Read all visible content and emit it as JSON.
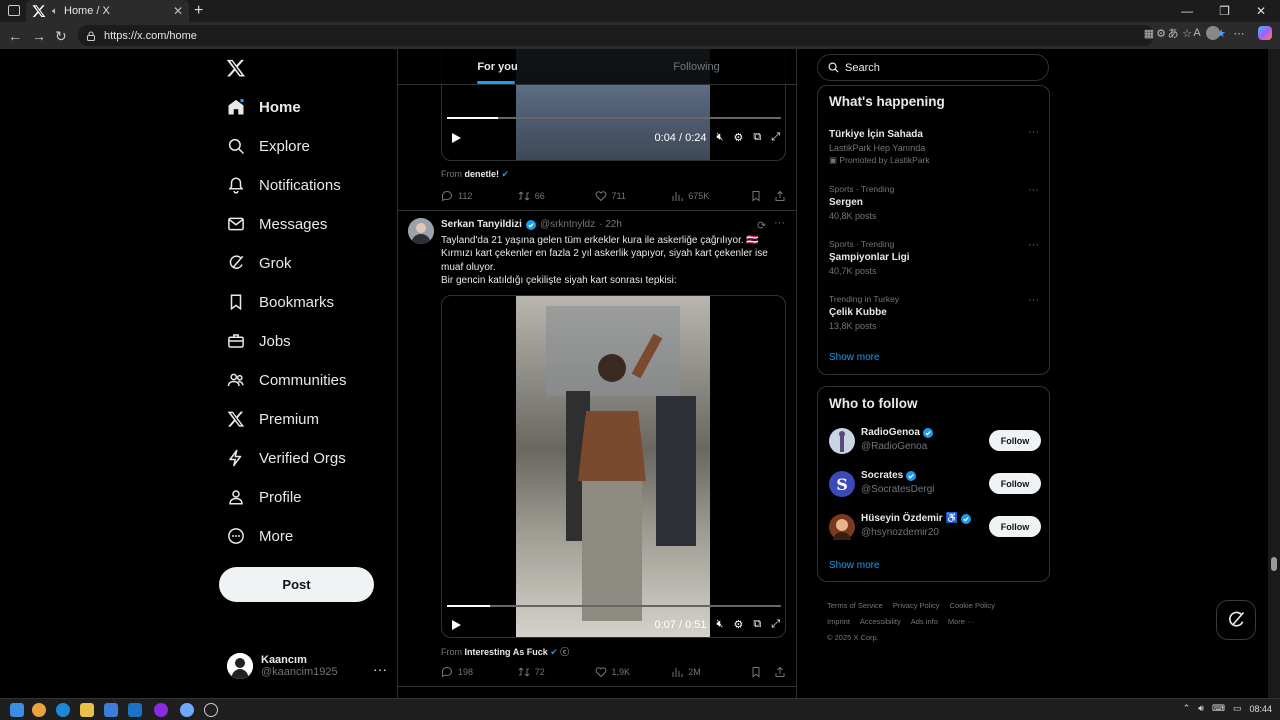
{
  "browser": {
    "tab_title": "Home / X",
    "url": "https://x.com/home",
    "window_controls": [
      "—",
      "❐",
      "✕"
    ]
  },
  "nav": {
    "items": [
      {
        "label": "Home",
        "icon": "home-icon"
      },
      {
        "label": "Explore",
        "icon": "search-icon"
      },
      {
        "label": "Notifications",
        "icon": "bell-icon"
      },
      {
        "label": "Messages",
        "icon": "mail-icon"
      },
      {
        "label": "Grok",
        "icon": "grok-icon"
      },
      {
        "label": "Bookmarks",
        "icon": "bookmark-icon"
      },
      {
        "label": "Jobs",
        "icon": "briefcase-icon"
      },
      {
        "label": "Communities",
        "icon": "people-icon"
      },
      {
        "label": "Premium",
        "icon": "x-icon"
      },
      {
        "label": "Verified Orgs",
        "icon": "lightning-icon"
      },
      {
        "label": "Profile",
        "icon": "person-icon"
      },
      {
        "label": "More",
        "icon": "more-circle-icon"
      }
    ],
    "post_label": "Post",
    "account": {
      "name": "Kaancım",
      "handle": "@kaancim1925"
    }
  },
  "timeline": {
    "tabs": [
      "For you",
      "Following"
    ],
    "tweet1": {
      "video_time": "0:04 / 0:24",
      "from_label": "From",
      "from_name": "denetle!",
      "stats": {
        "replies": "112",
        "reposts": "66",
        "likes": "711",
        "views": "675K"
      }
    },
    "tweet2": {
      "name": "Serkan Tanyildizi",
      "handle": "@srkntnyldz",
      "time": "· 22h",
      "text_lines": [
        "Tayland'da 21 yaşına gelen tüm erkekler kura ile askerliğe çağrılıyor. 🇹🇭",
        "Kırmızı kart çekenler en fazla 2 yıl askerlik yapıyor, siyah kart çekenler ise muaf oluyor.",
        "Bir gencin katıldığı çekilişte siyah kart sonrası tepkisi:"
      ],
      "video_time": "0:07 / 0:51",
      "from_label": "From",
      "from_name": "Interesting As Fuck",
      "stats": {
        "replies": "198",
        "reposts": "72",
        "likes": "1,9K",
        "views": "2M"
      }
    }
  },
  "sidebar": {
    "search_placeholder": "Search",
    "happening": {
      "title": "What's happening",
      "trends": [
        {
          "sub": "",
          "title": "Türkiye İçin Sahada",
          "count": "LastikPark Hep Yanında",
          "promo": "Promoted by LastikPark"
        },
        {
          "sub": "Sports · Trending",
          "title": "Sergen",
          "count": "40,8K posts",
          "promo": ""
        },
        {
          "sub": "Sports · Trending",
          "title": "Şampiyonlar Ligi",
          "count": "40,7K posts",
          "promo": ""
        },
        {
          "sub": "Trending in Turkey",
          "title": "Çelik Kubbe",
          "count": "13,8K posts",
          "promo": ""
        }
      ],
      "show_more": "Show more"
    },
    "who_to_follow": {
      "title": "Who to follow",
      "accounts": [
        {
          "name": "RadioGenoa",
          "handle": "@RadioGenoa",
          "button": "Follow"
        },
        {
          "name": "Socrates",
          "handle": "@SocratesDergi",
          "button": "Follow"
        },
        {
          "name": "Hüseyin Özdemir ♿",
          "handle": "@hsynozdemir20",
          "button": "Follow"
        }
      ],
      "show_more": "Show more"
    },
    "footer": {
      "links": [
        "Terms of Service",
        "Privacy Policy",
        "Cookie Policy",
        "Imprint",
        "Accessibility",
        "Ads info",
        "More ···"
      ],
      "copyright": "© 2025 X Corp."
    }
  },
  "taskbar": {
    "time": "08:44"
  },
  "colors": {
    "accent": "#1d9bf0",
    "background": "#000000",
    "border": "#2f3336",
    "muted": "#71767b"
  }
}
